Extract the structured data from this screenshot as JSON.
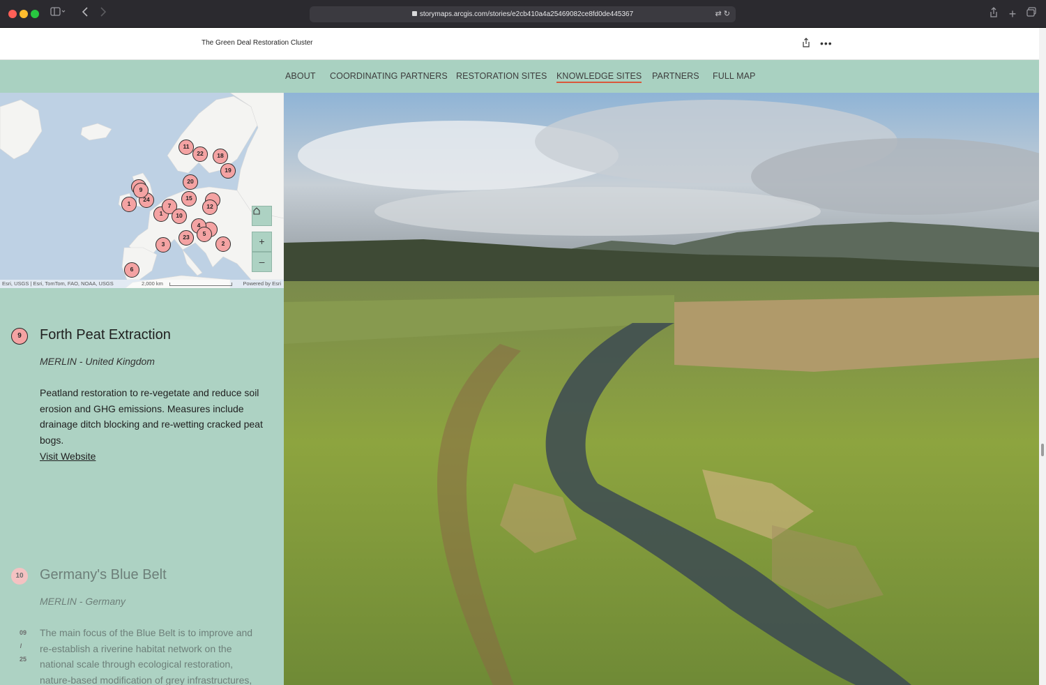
{
  "browser": {
    "url": "storymaps.arcgis.com/stories/e2cb410a4a25469082ce8fd0de445367"
  },
  "header": {
    "title": "The Green Deal Restoration Cluster"
  },
  "nav": {
    "items": [
      {
        "label": "ABOUT"
      },
      {
        "label": "COORDINATING PARTNERS"
      },
      {
        "label": "RESTORATION SITES"
      },
      {
        "label": "KNOWLEDGE SITES",
        "active": true
      },
      {
        "label": "PARTNERS"
      },
      {
        "label": "FULL MAP"
      }
    ]
  },
  "map": {
    "attribution": "Esri, USGS | Esri, TomTom, FAO, NOAA, USGS",
    "scale": "2,000 km",
    "powered": "Powered by Esri",
    "pins": [
      "11",
      "22",
      "18",
      "19",
      "20",
      "9",
      "24",
      "1",
      "15",
      "12",
      "7",
      "10",
      "4",
      "23",
      "3",
      "5",
      "2",
      "6",
      "1"
    ]
  },
  "sites": [
    {
      "number": "9",
      "title": "Forth Peat Extraction",
      "subtitle": "MERLIN - United Kingdom",
      "description": "Peatland restoration to re-vegetate and reduce soil erosion and GHG emissions. Measures include drainage ditch blocking and re-wetting cracked peat bogs.",
      "link": "Visit Website"
    },
    {
      "number": "10",
      "title": "Germany's Blue Belt",
      "subtitle": "MERLIN - Germany",
      "description": "The main focus of the Blue Belt is to improve and re-establish a riverine habitat network on the national scale through ecological restoration, nature-based modification of grey infrastructures,"
    }
  ],
  "counter": {
    "current": "09",
    "sep": "/",
    "total": "25"
  },
  "colors": {
    "nav_bg": "#a9d1c1",
    "panel_bg": "#add2c3",
    "pin": "#f4a3a3",
    "active_underline": "#d9583b"
  }
}
